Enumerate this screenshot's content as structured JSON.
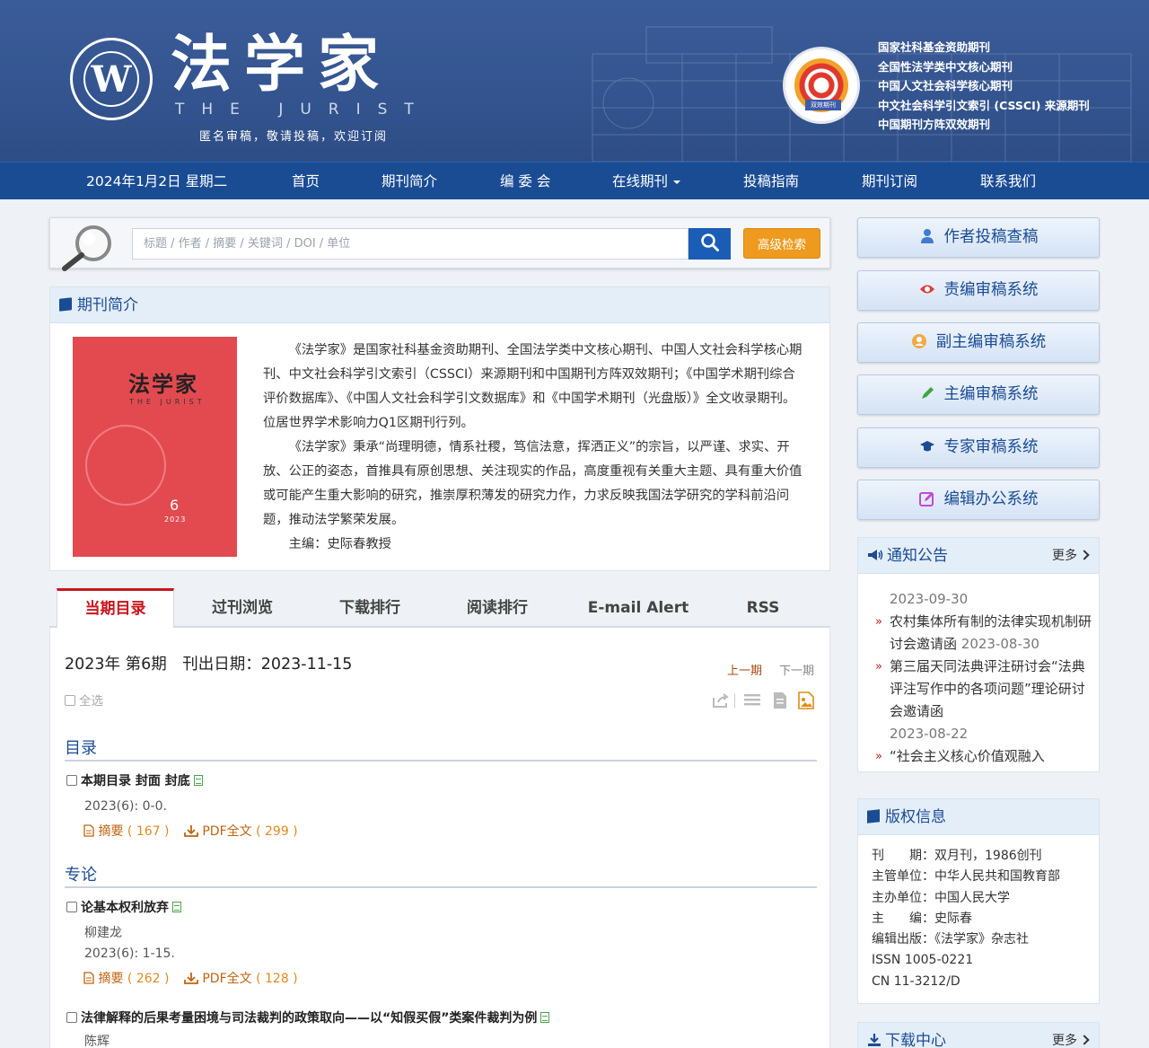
{
  "header": {
    "seal_letter": "W",
    "title": "法学家",
    "subtitle": "THE JURIST",
    "slogan": "匿名审稿，敬请投稿，欢迎订阅",
    "badge_label": "双效期刊",
    "qualifications": [
      "国家社科基金资助期刊",
      "全国性法学类中文核心期刊",
      "中国人文社会科学核心期刊",
      "中文社会科学引文索引 (CSSCI) 来源期刊",
      "中国期刊方阵双效期刊"
    ]
  },
  "nav": {
    "date": "2024年1月2日 星期二",
    "items": [
      "首页",
      "期刊简介",
      "编 委 会",
      "在线期刊",
      "投稿指南",
      "期刊订阅",
      "联系我们"
    ]
  },
  "search": {
    "placeholder": "标题 / 作者 / 摘要 / 关键词 / DOI / 单位",
    "advanced_label": "高级检索"
  },
  "intro": {
    "heading": "期刊简介",
    "cover_title": "法学家",
    "cover_subtitle": "THE JURIST",
    "cover_issue": "6",
    "cover_year": "2023",
    "paragraphs": [
      "《法学家》是国家社科基金资助期刊、全国法学类中文核心期刊、中国人文社会科学核心期刊、中文社会科学引文索引（CSSCI）来源期刊和中国期刊方阵双效期刊；《中国学术期刊综合评价数据库》、《中国人文社会科学引文数据库》和《中国学术期刊（光盘版）》全文收录期刊。位居世界学术影响力Q1区期刊行列。",
      "《法学家》秉承“尚理明德，情系社稷，笃信法意，挥洒正义”的宗旨，以严谨、求实、开放、公正的姿态，首推具有原创思想、关注现实的作品，高度重视有关重大主题、具有重大价值或可能产生重大影响的研究，推崇厚积薄发的研究力作，力求反映我国法学研究的学科前沿问题，推动法学繁荣发展。",
      "主编：史际春教授"
    ]
  },
  "tabs": [
    "当期目录",
    "过刊浏览",
    "下载排行",
    "阅读排行",
    "E-mail Alert",
    "RSS"
  ],
  "issue": {
    "title": "2023年 第6期　刊出日期：2023-11-15",
    "prev": "上一期",
    "next": "下一期",
    "select_all": "全选",
    "sections": [
      {
        "name": "目录",
        "articles": [
          {
            "title": "本期目录 封面 封底",
            "author": "",
            "pages": "2023(6): 0-0.",
            "abstract_label": "摘要",
            "abstract_count": "( 167 )",
            "pdf_label": "PDF全文",
            "pdf_count": "( 299 )"
          }
        ]
      },
      {
        "name": "专论",
        "articles": [
          {
            "title": "论基本权利放弃",
            "author": "柳建龙",
            "pages": "2023(6): 1-15.",
            "abstract_label": "摘要",
            "abstract_count": "( 262 )",
            "pdf_label": "PDF全文",
            "pdf_count": "( 128 )"
          },
          {
            "title": "法律解释的后果考量困境与司法裁判的政策取向——以“知假买假”类案件裁判为例",
            "author": "陈辉",
            "pages": "",
            "abstract_label": "",
            "abstract_count": "",
            "pdf_label": "",
            "pdf_count": ""
          }
        ]
      }
    ]
  },
  "sidebar": {
    "systems": [
      "作者投稿查稿",
      "责编审稿系统",
      "副主编审稿系统",
      "主编审稿系统",
      "专家审稿系统",
      "编辑办公系统"
    ],
    "notice": {
      "heading": "通知公告",
      "more": "更多",
      "first_date": "2023-09-30",
      "items": [
        {
          "title": "农村集体所有制的法律实现机制研讨会邀请函",
          "date": "2023-08-30"
        },
        {
          "title": "第三届天同法典评注研讨会“法典评注写作中的各项问题”理论研讨会邀请函",
          "date": "2023-08-22"
        },
        {
          "title": "“社会主义核心价值观融入",
          "date": ""
        }
      ]
    },
    "copyright": {
      "heading": "版权信息",
      "lines": [
        "刊　　期：双月刊，1986创刊",
        "主管单位：中华人民共和国教育部",
        "主办单位：中国人民大学",
        "主　　编：史际春",
        "编辑出版：《法学家》杂志社",
        "ISSN 1005-0221",
        "CN 11-3212/D"
      ]
    },
    "download": {
      "heading": "下载中心",
      "more": "更多"
    }
  },
  "colors": {
    "header_bg": "#33548f",
    "nav_bg": "#1a4c94",
    "accent_red": "#c8161d",
    "accent_orange": "#ee9a1e"
  }
}
